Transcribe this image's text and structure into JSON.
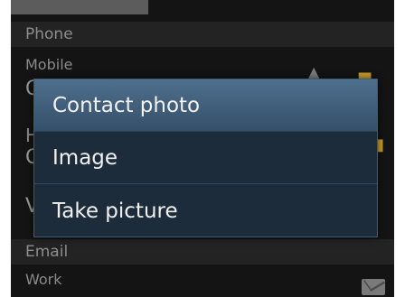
{
  "sections": {
    "phone_header": "Phone",
    "mobile_label": "Mobile",
    "mobile_value_stub": "C",
    "home_label_stub": "H",
    "home_value_stub": "C",
    "work_value_stub": "V",
    "email_header": "Email",
    "work_label": "Work"
  },
  "dialog": {
    "title": "Contact photo",
    "items": [
      {
        "label": "Image"
      },
      {
        "label": "Take picture"
      }
    ]
  },
  "icons": {
    "side_icon": "contact-card-icon",
    "up_arrow": "arrow-up-icon",
    "mail": "mail-icon"
  },
  "colors": {
    "dialog_title_bg": "#4e6f8c",
    "dialog_bg": "#1d2c3a",
    "screen_bg": "#141414",
    "accent_icon": "#c79a2a"
  }
}
